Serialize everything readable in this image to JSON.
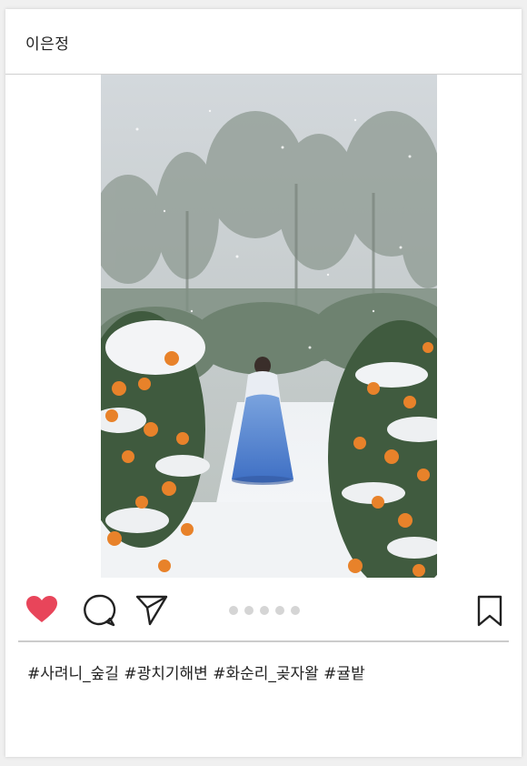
{
  "post": {
    "username": "이은정",
    "caption": "#사려니_숲길 #광치기해변 #화순리_곶자왈 #귤밭"
  },
  "photo": {
    "description_icon": "image-photo"
  },
  "actions": {
    "like_icon": "heart-icon",
    "comment_icon": "comment-icon",
    "share_icon": "send-icon",
    "save_icon": "bookmark-icon",
    "carousel_count": 5
  },
  "colors": {
    "like": "#e8455a",
    "icon_stroke": "#222222",
    "dot": "#d5d5d5",
    "divider": "#cccccc"
  }
}
